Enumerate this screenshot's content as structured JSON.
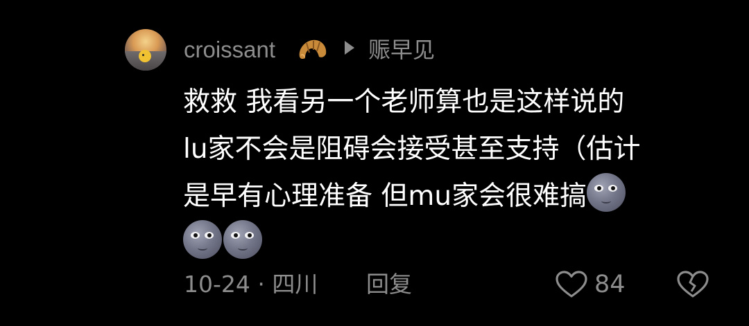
{
  "comment": {
    "author": {
      "name": "croissant",
      "badge_icon": "croissant-icon",
      "avatar_icon": "avatar-sunset-duck"
    },
    "reply_to": {
      "icon": "play-arrow-icon",
      "name": "赈早见"
    },
    "body_lines": [
      "救救 我看另一个老师算也是这样说的",
      "lu家不会是阻碍会接受甚至支持（估计",
      "是早有心理准备 但mu家会很难搞"
    ],
    "emoji": [
      "new-moon-face-emoji",
      "new-moon-face-emoji",
      "new-moon-face-emoji"
    ],
    "footer": {
      "date": "10-24",
      "separator": "·",
      "location": "四川",
      "reply_label": "回复",
      "like_count": "84",
      "like_icon": "heart-outline-icon",
      "dislike_icon": "broken-heart-outline-icon"
    }
  },
  "colors": {
    "background": "#000000",
    "text_primary": "#ffffff",
    "text_secondary": "#8d8d8d"
  }
}
